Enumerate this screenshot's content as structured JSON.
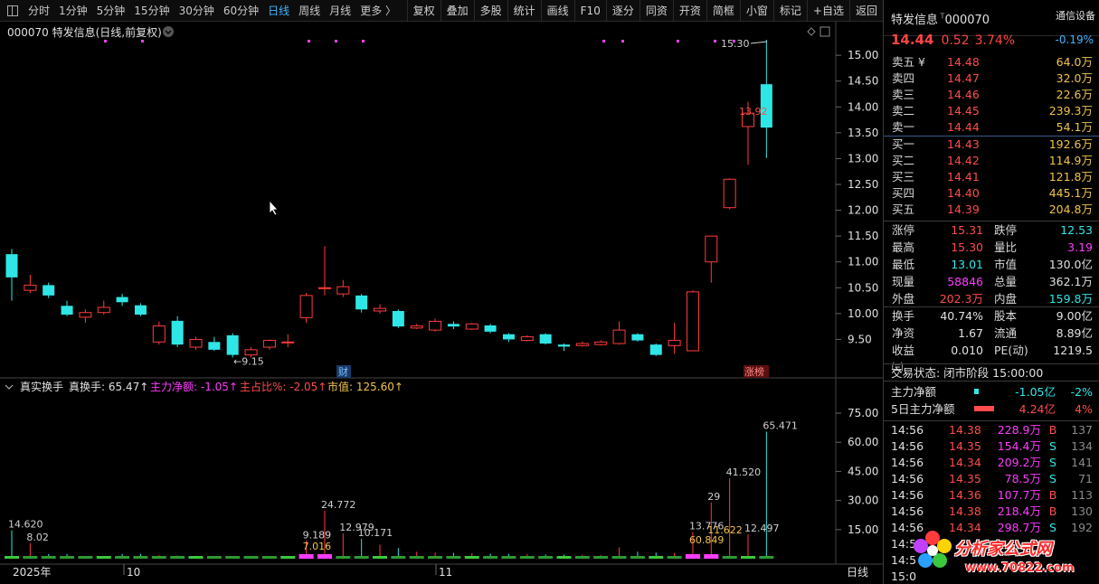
{
  "toolbar": {
    "periods": [
      "分时",
      "1分钟",
      "5分钟",
      "15分钟",
      "30分钟",
      "60分钟",
      "日线",
      "周线",
      "月线",
      "更多 〉"
    ],
    "active_period": "日线",
    "buttons": [
      "复权",
      "叠加",
      "多股",
      "统计",
      "画线",
      "F10",
      "逐分",
      "同资",
      "开资",
      "简框",
      "小窗",
      "标记",
      "+自选",
      "返回"
    ]
  },
  "chart": {
    "title": "000070 特发信息(日线,前复权)",
    "price_axis": [
      "15.00",
      "14.50",
      "14.00",
      "13.50",
      "13.00",
      "12.50",
      "12.00",
      "11.50",
      "11.00",
      "10.50",
      "10.00",
      "9.50"
    ],
    "high_label": "15.30",
    "low_label": "9.15",
    "marker_13_92": "13.92",
    "cai_label": "财",
    "zhangbang_label": "涨榜",
    "indicator_name": "真实换手",
    "indicator_values": {
      "zhs": "真换手: 65.47↑",
      "zljr": "主力净额: -1.05↑",
      "zzb": "主占比%: -2.05↑",
      "sz": "市值: 125.60↑"
    },
    "vol_axis": [
      "75.00",
      "60.00",
      "45.00",
      "30.00",
      "15.00"
    ],
    "x_axis": {
      "year": "2025年",
      "m10": "10",
      "m11": "11"
    },
    "period_label": "日线"
  },
  "chart_data": {
    "type": "candlestick",
    "candles": [
      {
        "o": 11.15,
        "c": 10.7,
        "h": 11.25,
        "l": 10.25
      },
      {
        "o": 10.45,
        "c": 10.55,
        "h": 10.75,
        "l": 10.4
      },
      {
        "o": 10.55,
        "c": 10.35,
        "h": 10.6,
        "l": 10.3
      },
      {
        "o": 10.15,
        "c": 9.98,
        "h": 10.25,
        "l": 9.95
      },
      {
        "o": 9.93,
        "c": 10.02,
        "h": 10.08,
        "l": 9.82
      },
      {
        "o": 10.02,
        "c": 10.12,
        "h": 10.25,
        "l": 9.98
      },
      {
        "o": 10.32,
        "c": 10.22,
        "h": 10.38,
        "l": 10.15
      },
      {
        "o": 10.16,
        "c": 9.98,
        "h": 10.2,
        "l": 9.95
      },
      {
        "o": 9.45,
        "c": 9.76,
        "h": 9.85,
        "l": 9.4
      },
      {
        "o": 9.86,
        "c": 9.4,
        "h": 9.95,
        "l": 9.35
      },
      {
        "o": 9.35,
        "c": 9.5,
        "h": 9.55,
        "l": 9.3
      },
      {
        "o": 9.45,
        "c": 9.3,
        "h": 9.55,
        "l": 9.28
      },
      {
        "o": 9.58,
        "c": 9.2,
        "h": 9.62,
        "l": 9.15
      },
      {
        "o": 9.2,
        "c": 9.3,
        "h": 9.35,
        "l": 9.15
      },
      {
        "o": 9.35,
        "c": 9.48,
        "h": 9.5,
        "l": 9.3
      },
      {
        "o": 9.45,
        "c": 9.45,
        "h": 9.6,
        "l": 9.35
      },
      {
        "o": 9.92,
        "c": 10.35,
        "h": 10.4,
        "l": 9.82
      },
      {
        "o": 10.5,
        "c": 10.5,
        "h": 11.3,
        "l": 10.35
      },
      {
        "o": 10.38,
        "c": 10.52,
        "h": 10.65,
        "l": 10.32
      },
      {
        "o": 10.35,
        "c": 10.08,
        "h": 10.38,
        "l": 10.02
      },
      {
        "o": 10.05,
        "c": 10.1,
        "h": 10.18,
        "l": 10.0
      },
      {
        "o": 10.05,
        "c": 9.75,
        "h": 10.08,
        "l": 9.72
      },
      {
        "o": 9.72,
        "c": 9.76,
        "h": 9.8,
        "l": 9.7
      },
      {
        "o": 9.68,
        "c": 9.85,
        "h": 9.9,
        "l": 9.65
      },
      {
        "o": 9.8,
        "c": 9.75,
        "h": 9.85,
        "l": 9.7
      },
      {
        "o": 9.7,
        "c": 9.8,
        "h": 9.82,
        "l": 9.68
      },
      {
        "o": 9.77,
        "c": 9.65,
        "h": 9.8,
        "l": 9.62
      },
      {
        "o": 9.6,
        "c": 9.5,
        "h": 9.62,
        "l": 9.45
      },
      {
        "o": 9.48,
        "c": 9.55,
        "h": 9.58,
        "l": 9.46
      },
      {
        "o": 9.6,
        "c": 9.42,
        "h": 9.62,
        "l": 9.4
      },
      {
        "o": 9.4,
        "c": 9.36,
        "h": 9.42,
        "l": 9.28
      },
      {
        "o": 9.38,
        "c": 9.42,
        "h": 9.46,
        "l": 9.36
      },
      {
        "o": 9.4,
        "c": 9.45,
        "h": 9.48,
        "l": 9.38
      },
      {
        "o": 9.42,
        "c": 9.68,
        "h": 9.85,
        "l": 9.4
      },
      {
        "o": 9.6,
        "c": 9.48,
        "h": 9.62,
        "l": 9.46
      },
      {
        "o": 9.4,
        "c": 9.2,
        "h": 9.42,
        "l": 9.18
      },
      {
        "o": 9.38,
        "c": 9.48,
        "h": 9.82,
        "l": 9.22
      },
      {
        "o": 9.28,
        "c": 10.42,
        "h": 10.45,
        "l": 9.28
      },
      {
        "o": 11.0,
        "c": 11.5,
        "h": 11.5,
        "l": 10.6
      },
      {
        "o": 12.05,
        "c": 12.6,
        "h": 12.62,
        "l": 12.02
      },
      {
        "o": 13.62,
        "c": 13.88,
        "h": 14.1,
        "l": 12.88
      },
      {
        "o": 14.44,
        "c": 13.6,
        "h": 15.3,
        "l": 13.01
      }
    ],
    "turnover": [
      14.62,
      8.02,
      2.36,
      2.36,
      1.227,
      1.2,
      2.52,
      2.48,
      1.8,
      1.6,
      1.5,
      1.4,
      1.2,
      1.0,
      1.0,
      1.0,
      9.189,
      24.772,
      12.979,
      10.171,
      7.25,
      5.477,
      3.6,
      3.2,
      3.0,
      2.8,
      2.6,
      2.5,
      2.3,
      2.2,
      2.1,
      2.0,
      1.9,
      5.865,
      3.6,
      3.2,
      3.0,
      13.776,
      29,
      41.52,
      12.497,
      65.471
    ],
    "turnover_labels": [
      "14.620",
      "8.02",
      "24.772",
      "12.979",
      "10.171",
      "9.189",
      "7.016",
      "13.776",
      "29",
      "11.622",
      "60.849",
      "41.520",
      "12.497",
      "65.471"
    ],
    "y_range": [
      9.0,
      15.3
    ],
    "vol_range": [
      0,
      82
    ]
  },
  "quote": {
    "name": "特发信息",
    "code": "000070",
    "industry": "通信设备",
    "industry_pct": "-0.19%",
    "price": "14.44",
    "change": "0.52",
    "change_pct": "3.74%"
  },
  "order_book": {
    "asks": [
      {
        "label": "卖五 ¥",
        "price": "14.48",
        "vol": "64.0万"
      },
      {
        "label": "卖四",
        "price": "14.47",
        "vol": "32.0万"
      },
      {
        "label": "卖三",
        "price": "14.46",
        "vol": "22.6万"
      },
      {
        "label": "卖二",
        "price": "14.45",
        "vol": "239.3万"
      },
      {
        "label": "卖一",
        "price": "14.44",
        "vol": "54.1万"
      }
    ],
    "bids": [
      {
        "label": "买一",
        "price": "14.43",
        "vol": "192.6万"
      },
      {
        "label": "买二",
        "price": "14.42",
        "vol": "114.9万"
      },
      {
        "label": "买三",
        "price": "14.41",
        "vol": "121.8万"
      },
      {
        "label": "买四",
        "price": "14.40",
        "vol": "445.1万"
      },
      {
        "label": "买五",
        "price": "14.39",
        "vol": "204.8万"
      }
    ]
  },
  "stats": [
    {
      "k1": "涨停",
      "v1": "15.31",
      "c1": "red",
      "k2": "跌停",
      "v2": "12.53",
      "c2": "cyan"
    },
    {
      "k1": "最高",
      "v1": "15.30",
      "c1": "red",
      "k2": "量比",
      "v2": "3.19",
      "c2": "mag"
    },
    {
      "k1": "最低",
      "v1": "13.01",
      "c1": "cyan",
      "k2": "市值",
      "v2": "130.0亿",
      "c2": "wht"
    },
    {
      "k1": "现量",
      "v1": "58846",
      "c1": "mag",
      "k2": "总量",
      "v2": "362.1万",
      "c2": "wht"
    },
    {
      "k1": "外盘",
      "v1": "202.3万",
      "c1": "red",
      "k2": "内盘",
      "v2": "159.8万",
      "c2": "cyan"
    },
    {
      "k1": "换手",
      "v1": "40.74%",
      "c1": "wht",
      "k2": "股本",
      "v2": "9.00亿",
      "c2": "wht"
    },
    {
      "k1": "净资",
      "v1": "1.67",
      "c1": "wht",
      "k2": "流通",
      "v2": "8.89亿",
      "c2": "wht"
    },
    {
      "k1": "收益㈢",
      "v1": "0.010",
      "c1": "wht",
      "k2": "PE(动)",
      "v2": "1219.5",
      "c2": "wht"
    }
  ],
  "trade_status": "交易状态: 闭市阶段 15:00:00",
  "flow": [
    {
      "k": "主力净额",
      "v": "-1.05亿",
      "p": "-2%",
      "color": "cyan"
    },
    {
      "k": "5日主力净额",
      "v": "4.24亿",
      "p": "4%",
      "color": "red"
    }
  ],
  "ticks": [
    {
      "t": "14:56",
      "p": "14.38",
      "v": "228.9万",
      "d": "B",
      "n": "137"
    },
    {
      "t": "14:56",
      "p": "14.35",
      "v": "154.4万",
      "d": "S",
      "n": "134"
    },
    {
      "t": "14:56",
      "p": "14.34",
      "v": "209.2万",
      "d": "S",
      "n": "141"
    },
    {
      "t": "14:56",
      "p": "14.35",
      "v": "78.5万",
      "d": "S",
      "n": "71"
    },
    {
      "t": "14:56",
      "p": "14.36",
      "v": "107.7万",
      "d": "B",
      "n": "113"
    },
    {
      "t": "14:56",
      "p": "14.38",
      "v": "218.4万",
      "d": "B",
      "n": "130"
    },
    {
      "t": "14:56",
      "p": "14.34",
      "v": "298.7万",
      "d": "S",
      "n": "192"
    },
    {
      "t": "14:5",
      "p": "",
      "v": "",
      "d": "",
      "n": ""
    },
    {
      "t": "14:5",
      "p": "",
      "v": "",
      "d": "",
      "n": ""
    },
    {
      "t": "15:0",
      "p": "",
      "v": "",
      "d": "",
      "n": ""
    }
  ],
  "logo": {
    "text": "分析家公式网",
    "url": "www.70822.com"
  },
  "colors": {
    "up": "#ff3b3b",
    "down": "#2fe6e6",
    "accent": "#43b3ff",
    "magenta": "#ff3cff",
    "yellow": "#f0c34c"
  }
}
